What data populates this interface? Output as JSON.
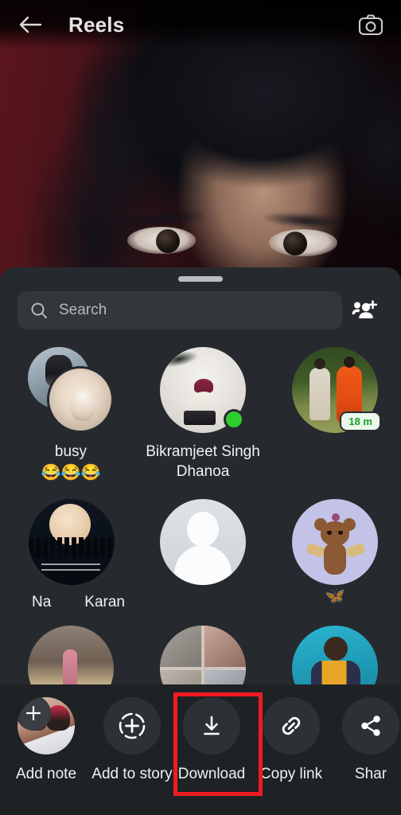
{
  "topbar": {
    "back_icon": "arrow-left-icon",
    "title": "Reels",
    "camera_icon": "camera-icon"
  },
  "sheet": {
    "handle": "drag-handle",
    "search": {
      "placeholder": "Search",
      "value": "",
      "icon": "search-icon"
    },
    "add_people_icon": "add-people-icon",
    "rows": [
      [
        {
          "name": "busy",
          "emoji": "😂😂😂",
          "avatar": "group-photo",
          "badge": null,
          "online": false
        },
        {
          "name": "Bikramjeet Singh Dhanoa",
          "emoji": "",
          "avatar": "bikramjeet-photo",
          "badge": null,
          "online": true
        },
        {
          "name": "",
          "emoji": "",
          "avatar": "couple-photo",
          "badge": "18 m",
          "online": false
        }
      ],
      [
        {
          "name": "Na",
          "emoji": "",
          "avatar": "moon-photo",
          "badge": null,
          "online": false,
          "second_label": "Karan"
        },
        {
          "name": "",
          "emoji": "",
          "avatar": "default-avatar",
          "badge": null,
          "online": false
        },
        {
          "name": "",
          "emoji": "🦋",
          "avatar": "teddy-bear-photo",
          "badge": null,
          "online": false
        }
      ],
      [
        {
          "name": "",
          "emoji": "",
          "avatar": "photo-a",
          "badge": null,
          "online": false
        },
        {
          "name": "",
          "emoji": "",
          "avatar": "photo-collage",
          "badge": null,
          "online": false
        },
        {
          "name": "",
          "emoji": "",
          "avatar": "photo-c",
          "badge": null,
          "online": false
        }
      ]
    ]
  },
  "actions": [
    {
      "label": "Add note",
      "icon": "plus-icon"
    },
    {
      "label": "Add to story",
      "icon": "add-to-story-icon"
    },
    {
      "label": "Download",
      "icon": "download-icon"
    },
    {
      "label": "Copy link",
      "icon": "link-icon"
    },
    {
      "label": "Shar",
      "icon": "share-icon"
    }
  ],
  "highlight": {
    "target": "Download",
    "color": "#ee1b24"
  },
  "colors": {
    "sheet_bg": "#262a2e",
    "action_bar_bg": "#1f2225",
    "search_bg": "#33373c",
    "accent_online": "#2ecc2e",
    "badge_text": "#1d9c2f",
    "highlight": "#ee1b24"
  }
}
